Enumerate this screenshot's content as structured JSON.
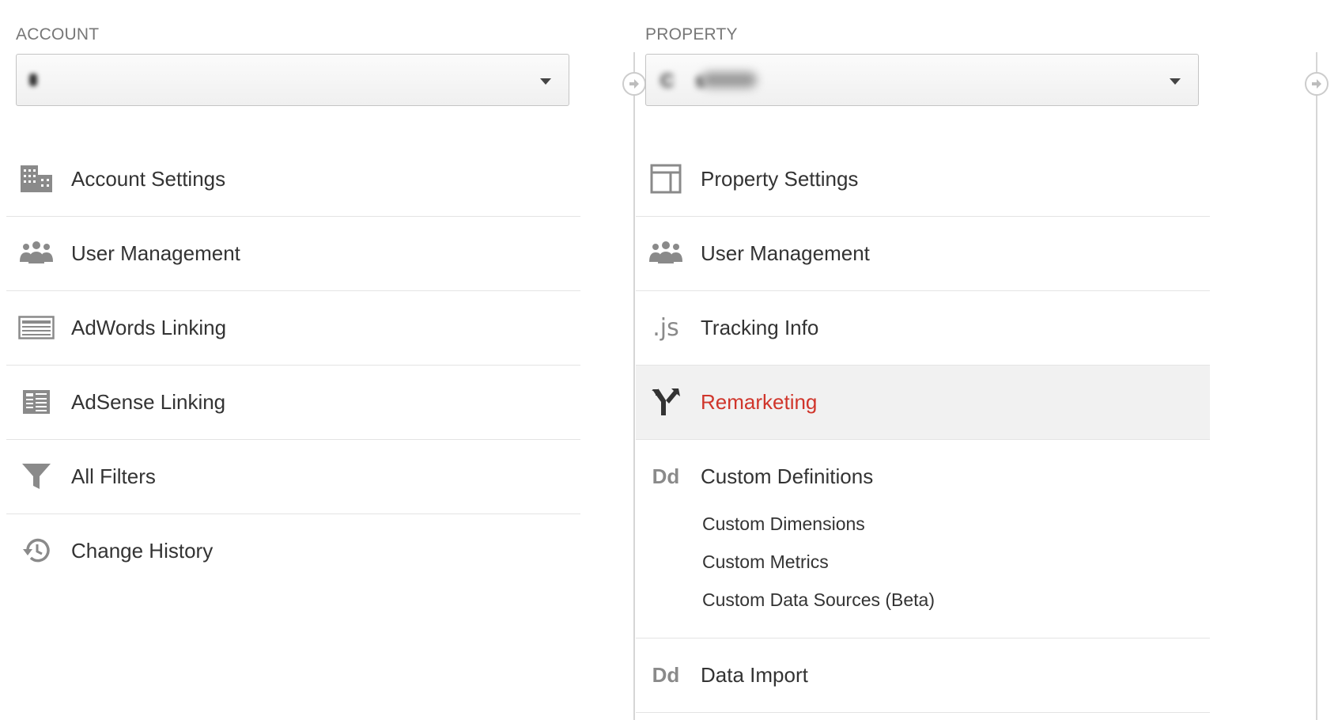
{
  "account": {
    "heading": "ACCOUNT",
    "selected": "",
    "items": [
      {
        "label": "Account Settings",
        "icon": "building-icon"
      },
      {
        "label": "User Management",
        "icon": "users-icon"
      },
      {
        "label": "AdWords Linking",
        "icon": "adwords-icon"
      },
      {
        "label": "AdSense Linking",
        "icon": "adsense-icon"
      },
      {
        "label": "All Filters",
        "icon": "filter-icon"
      },
      {
        "label": "Change History",
        "icon": "history-icon"
      }
    ]
  },
  "property": {
    "heading": "PROPERTY",
    "selected": "C   s",
    "items": [
      {
        "label": "Property Settings",
        "icon": "property-settings-icon"
      },
      {
        "label": "User Management",
        "icon": "users-icon"
      },
      {
        "label": "Tracking Info",
        "icon": "js-icon",
        "icon_text": ".js"
      },
      {
        "label": "Remarketing",
        "icon": "remarketing-icon",
        "active": true
      },
      {
        "label": "Custom Definitions",
        "icon": "dd-icon",
        "icon_text": "Dd",
        "children": [
          "Custom Dimensions",
          "Custom Metrics",
          "Custom Data Sources (Beta)"
        ]
      },
      {
        "label": "Data Import",
        "icon": "dd-icon",
        "icon_text": "Dd"
      }
    ]
  },
  "colors": {
    "active_label": "#d0352b",
    "active_bg": "#f1f1f1",
    "icon": "#8a8a8a"
  }
}
